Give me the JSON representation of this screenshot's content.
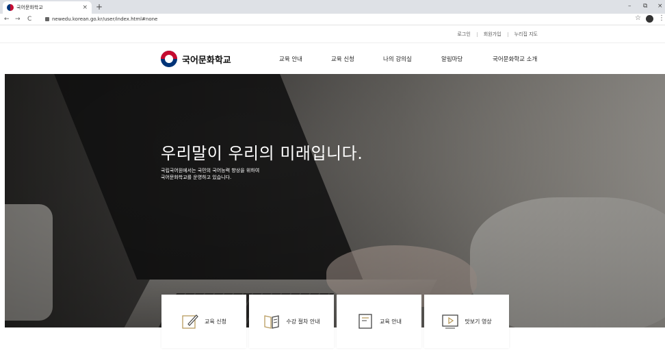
{
  "browser": {
    "tab_title": "국어문화학교",
    "tab_close": "×",
    "new_tab": "+",
    "url": "newedu.korean.go.kr/user/index.html#none",
    "nav_back": "←",
    "nav_forward": "→",
    "nav_reload": "C",
    "star": "☆",
    "menu": "⋮",
    "minimize": "–",
    "maximize": "⧉",
    "close": "×"
  },
  "utility": {
    "login": "로그인",
    "signup": "회원가입",
    "sitemap": "누리집 지도"
  },
  "header": {
    "logo_text": "국어문화학교",
    "menu": [
      "교육 안내",
      "교육 신청",
      "나의 강의실",
      "알림마당",
      "국어문화학교 소개"
    ]
  },
  "hero": {
    "title": "우리말이 우리의 미래입니다.",
    "subtitle_line1": "국립국어원에서는 국민의 국어능력 향상을 위하여",
    "subtitle_line2": "국어문화학교를 운영하고 있습니다."
  },
  "quick_menu": [
    {
      "label": "교육 신청",
      "icon": "pencil-icon"
    },
    {
      "label": "수강 절차 안내",
      "icon": "book-icon"
    },
    {
      "label": "교육 안내",
      "icon": "document-icon"
    },
    {
      "label": "맛보기 영상",
      "icon": "video-icon"
    }
  ],
  "colors": {
    "accent": "#b89b5e",
    "logo_red": "#c60c30",
    "logo_blue": "#003478"
  }
}
